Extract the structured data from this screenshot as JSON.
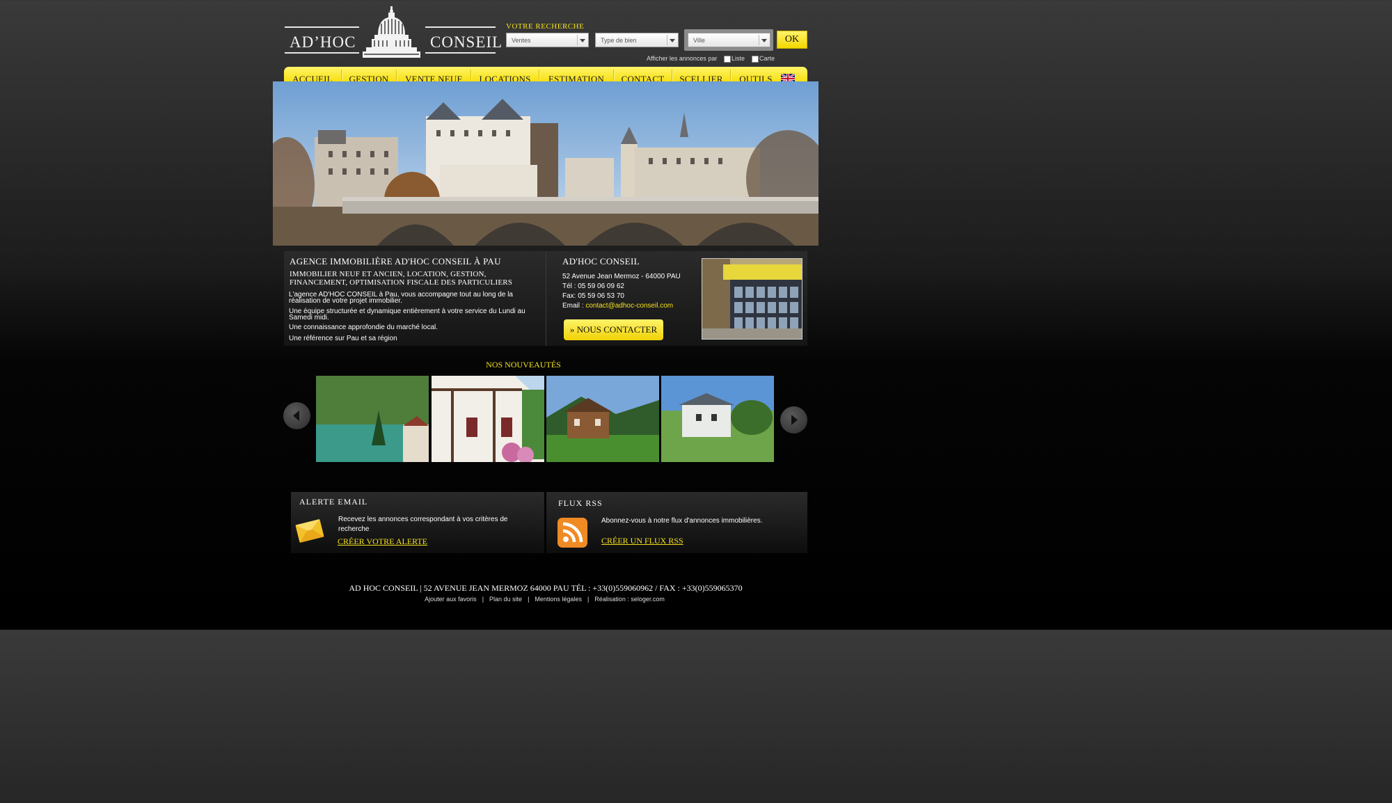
{
  "logo": {
    "left": "AD’HOC",
    "right": "CONSEIL"
  },
  "search": {
    "title": "VOTRE RECHERCHE",
    "transaction": "Ventes",
    "property_type": "Type de bien",
    "city": "Ville",
    "ok": "OK",
    "display_label": "Afficher les annonces par",
    "list_label": "Liste",
    "map_label": "Carte"
  },
  "nav": {
    "items": [
      "ACCUEIL",
      "GESTION",
      "VENTE NEUF",
      "LOCATIONS",
      "ESTIMATION",
      "CONTACT",
      "SCELLIER",
      "OUTILS"
    ]
  },
  "intro": {
    "title": "AGENCE IMMOBILIÈRE AD'HOC CONSEIL À PAU",
    "subtitle": "IMMOBILIER NEUF ET ANCIEN, LOCATION, GESTION, FINANCEMENT, OPTIMISATION FISCALE DES PARTICULIERS",
    "p1": "L'agence AD'HOC CONSEIL à Pau, vous accompagne tout au long de la réalisation de votre projet immobilier.",
    "p2": "Une équipe structurée et dynamique entièrement à votre service du Lundi au Samedi midi.",
    "p3": "Une connaissance approfondie du marché local.",
    "p4": "Une référence sur Pau et sa région"
  },
  "contact": {
    "name": "AD'HOC CONSEIL",
    "address": "52 Avenue Jean Mermoz - 64000 PAU",
    "tel": "Tél : 05 59 06 09 62",
    "fax": "Fax: 05 59 06 53 70",
    "email_label": "Email : ",
    "email": "contact@adhoc-conseil.com",
    "button": "» NOUS CONTACTER"
  },
  "nouveautes": {
    "title": "NOS NOUVEAUTÉS"
  },
  "alert": {
    "title": "ALERTE EMAIL",
    "text": "Recevez les annonces correspondant à vos critères de recherche",
    "link": "CRÉER VOTRE ALERTE"
  },
  "rss": {
    "title": "FLUX RSS",
    "text": "Abonnez-vous à notre flux d'annonces immobilières.",
    "link": "CRÉER UN FLUX RSS"
  },
  "footer": {
    "main": "AD HOC CONSEIL  |  52 AVENUE JEAN MERMOZ 64000 PAU TÉL : +33(0)559060962 / FAX : +33(0)559065370",
    "links": [
      "Ajouter aux favoris",
      "Plan du site",
      "Mentions légales",
      "Réalisation : seloger.com"
    ]
  },
  "colors": {
    "accent": "#f5e21c",
    "nav": "#f8e21a",
    "background": "#000000"
  }
}
